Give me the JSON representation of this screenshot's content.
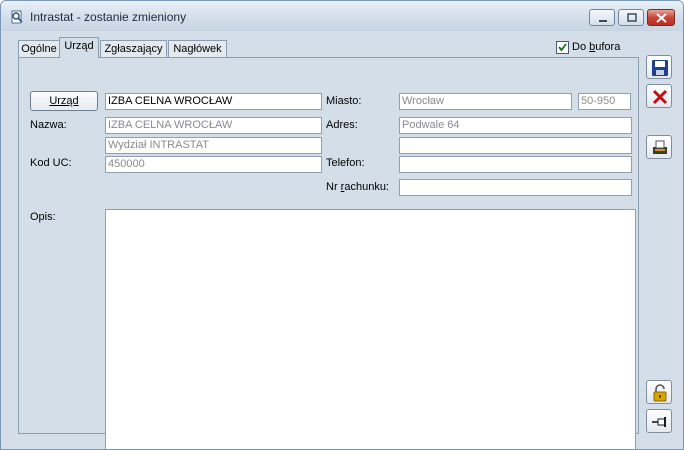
{
  "window": {
    "title": "Intrastat - zostanie zmieniony",
    "app_icon": "search-document-icon"
  },
  "tabs": [
    {
      "label": "Ogólne",
      "active": false
    },
    {
      "label": "Urząd",
      "active": true
    },
    {
      "label": "Zgłaszający",
      "active": false
    },
    {
      "label": "Nagłówek",
      "active": false
    }
  ],
  "buffer_checkbox": {
    "label_prefix": "Do ",
    "label_underlined": "b",
    "label_rest": "ufora",
    "checked": true
  },
  "office_button": {
    "label": "Urząd"
  },
  "office_field": {
    "value": "IZBA CELNA WROCŁAW"
  },
  "labels": {
    "nazwa": "Nazwa:",
    "kod_uc": "Kod UC:",
    "miasto": "Miasto:",
    "adres": "Adres:",
    "telefon": "Telefon:",
    "nr_rachunku_prefix": "Nr ",
    "nr_rachunku_underlined": "r",
    "nr_rachunku_rest": "achunku:",
    "opis": "Opis:"
  },
  "fields": {
    "nazwa_line1": "IZBA CELNA WROCŁAW",
    "nazwa_line2": "Wydział INTRASTAT",
    "kod_uc": "450000",
    "miasto": "Wrocław",
    "kod_pocztowy": "50-950",
    "adres_line1": "Podwale 64",
    "adres_line2": "",
    "telefon": "",
    "nr_rachunku": "",
    "opis": ""
  },
  "side_buttons": [
    {
      "icon": "save-icon",
      "color": "#1f3f8f"
    },
    {
      "icon": "cancel-icon",
      "color": "#c01010"
    },
    {
      "icon": "print-icon",
      "color": "#d09a00"
    },
    {
      "icon": "unlock-icon",
      "color": "#d8a400"
    },
    {
      "icon": "pin-icon",
      "color": "#1a1a1a"
    }
  ]
}
